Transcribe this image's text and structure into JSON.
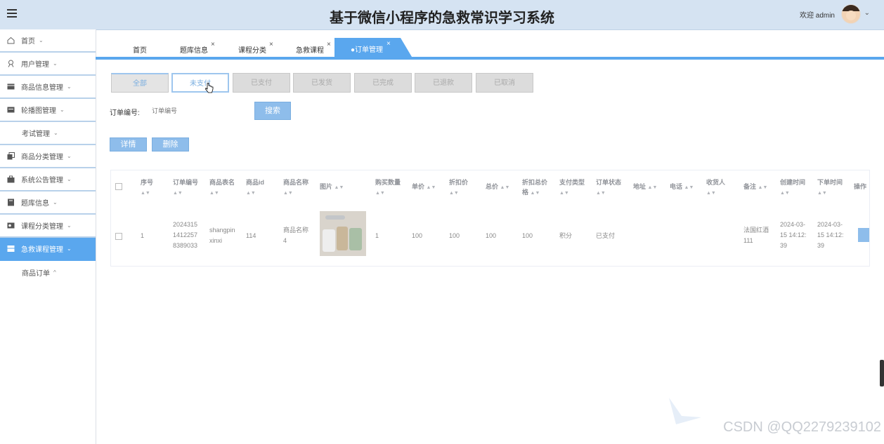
{
  "header": {
    "title": "基于微信小程序的急救常识学习系统",
    "welcome": "欢迎 admin",
    "caret": "⌄"
  },
  "sidebar": {
    "items": [
      {
        "label": "首页",
        "icon": "home-icon",
        "arrow": "⌄"
      },
      {
        "label": "用户管理",
        "icon": "user-icon",
        "arrow": "⌄"
      },
      {
        "label": "商品信息管理",
        "icon": "product-icon",
        "arrow": "⌄"
      },
      {
        "label": "轮播图管理",
        "icon": "carousel-icon",
        "arrow": "⌄"
      },
      {
        "label": "考试管理",
        "icon": "",
        "arrow": "⌄"
      },
      {
        "label": "商品分类管理",
        "icon": "category-icon",
        "arrow": "⌄"
      },
      {
        "label": "系统公告管理",
        "icon": "notice-icon",
        "arrow": "⌄"
      },
      {
        "label": "题库信息",
        "icon": "question-bank-icon",
        "arrow": "⌄"
      },
      {
        "label": "课程分类管理",
        "icon": "course-category-icon",
        "arrow": "⌄"
      },
      {
        "label": "急救课程管理",
        "icon": "course-icon",
        "arrow": "⌄"
      }
    ],
    "sub_item": {
      "label": "商品订单",
      "arrow": "^"
    }
  },
  "tabs": [
    {
      "label": "首页"
    },
    {
      "label": "题库信息",
      "close": "×"
    },
    {
      "label": "课程分类",
      "close": "×"
    },
    {
      "label": "急救课程",
      "close": "×"
    },
    {
      "label": "●订单管理",
      "close": "×"
    }
  ],
  "status_filters": [
    "全部",
    "未支付",
    "已支付",
    "已发货",
    "已完成",
    "已退款",
    "已取消"
  ],
  "search": {
    "label": "订单编号:",
    "placeholder": "订单编号",
    "button": "搜索"
  },
  "actions": {
    "detail": "详情",
    "delete": "删除"
  },
  "table": {
    "headers": [
      "序号",
      "订单编号",
      "商品表名",
      "商品id",
      "商品名称",
      "图片",
      "购买数量",
      "单价",
      "折扣价",
      "总价",
      "折扣总价格",
      "支付类型",
      "订单状态",
      "地址",
      "电话",
      "收货人",
      "备注",
      "创建时间",
      "下单时间",
      "操作"
    ],
    "sort_glyph": "▲▼",
    "rows": [
      {
        "index": "1",
        "order_no": [
          "2024315",
          "1412257",
          "8389033"
        ],
        "table_name": [
          "shangpin",
          "xinxi"
        ],
        "product_id": "114",
        "product_name": [
          "商品名称",
          "4"
        ],
        "quantity": "1",
        "price": "100",
        "discount_price": "100",
        "total": "100",
        "discount_total": "100",
        "pay_type": "积分",
        "status": "已支付",
        "address": "",
        "phone": "",
        "consignee": "",
        "remark": [
          "法国红酒",
          "111"
        ],
        "created": [
          "2024-03-",
          "15 14:12:",
          "39"
        ],
        "ordered": [
          "2024-03-",
          "15 14:12:",
          "39"
        ]
      }
    ]
  },
  "watermark": "CSDN @QQ2279239102",
  "colors": {
    "accent": "#5aa7ee",
    "header_bg": "#d5e3f2",
    "button": "#8ebdeb"
  }
}
